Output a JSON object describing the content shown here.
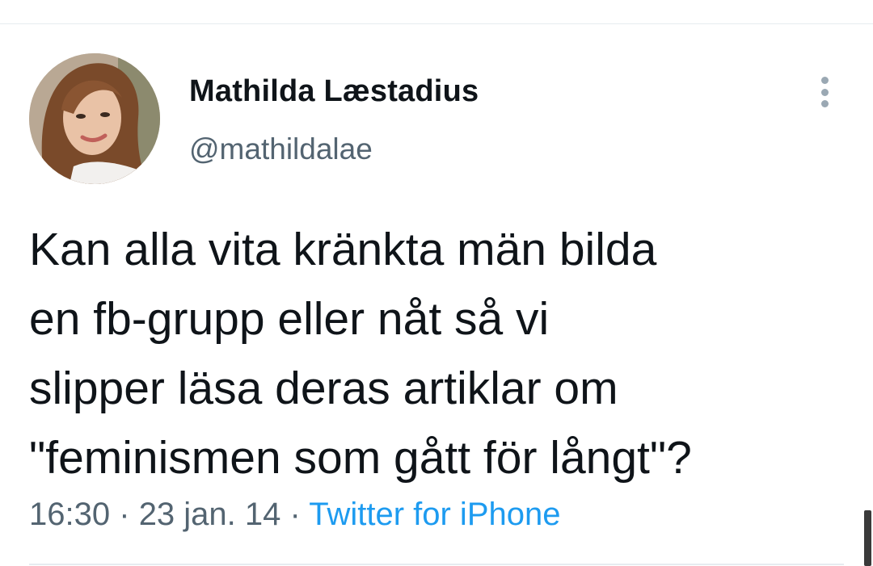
{
  "tweet": {
    "author": {
      "display_name": "Mathilda Læstadius",
      "handle": "@mathildalae",
      "avatar_icon": "profile-photo"
    },
    "text_lines": [
      "Kan alla vita kränkta män bilda",
      "en fb-grupp eller nåt så vi",
      "slipper läsa deras artiklar om",
      "\"feminismen som gått för långt\"?"
    ],
    "time": "16:30",
    "separator": "·",
    "date": "23 jan. 14",
    "source": "Twitter for iPhone",
    "more_icon": "vertical-ellipsis-icon"
  },
  "colors": {
    "text_primary": "#0f1419",
    "text_secondary": "#536471",
    "link": "#1d9bf0",
    "divider": "#e6ecf0"
  }
}
